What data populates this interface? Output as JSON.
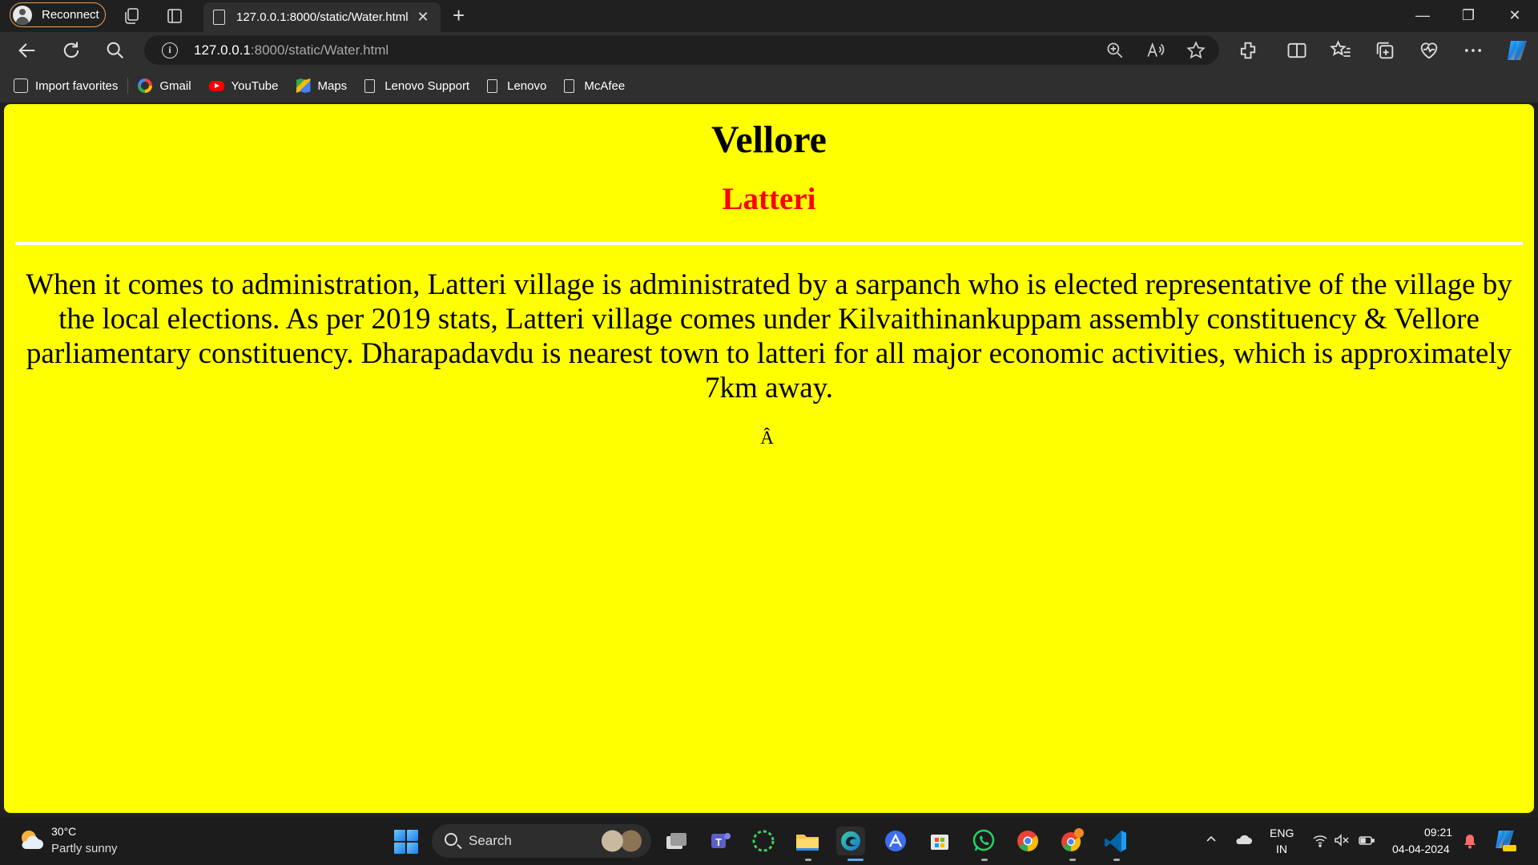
{
  "browser": {
    "profile_label": "Reconnect",
    "tab_title": "127.0.0.1:8000/static/Water.html",
    "tab_close": "✕",
    "new_tab": "+",
    "url_host": "127.0.0.1",
    "url_path": ":8000/static/Water.html",
    "info_glyph": "i",
    "window_controls": {
      "minimize": "—",
      "restore": "❐",
      "close": "✕"
    }
  },
  "favorites": [
    {
      "label": "Import favorites",
      "icon": "import-icon"
    },
    {
      "label": "Gmail",
      "icon": "google-icon"
    },
    {
      "label": "YouTube",
      "icon": "youtube-icon"
    },
    {
      "label": "Maps",
      "icon": "maps-icon"
    },
    {
      "label": "Lenovo Support",
      "icon": "document-icon"
    },
    {
      "label": "Lenovo",
      "icon": "document-icon"
    },
    {
      "label": "McAfee",
      "icon": "document-icon"
    }
  ],
  "page": {
    "heading": "Vellore",
    "subheading": "Latteri",
    "paragraph": "When it comes to administration, Latteri village is administrated by a sarpanch who is elected representative of the village by the local elections. As per 2019 stats, Latteri village comes under Kilvaithinankuppam assembly constituency & Vellore parliamentary constituency. Dharapadavdu is nearest town to latteri for all major economic activities, which is approximately 7km away.",
    "stray_char": "Â",
    "colors": {
      "background": "#ffff00",
      "subheading": "#ff0000",
      "rule": "#ffffff"
    }
  },
  "taskbar": {
    "weather_temp": "30°C",
    "weather_desc": "Partly sunny",
    "search_label": "Search",
    "lang_top": "ENG",
    "lang_bottom": "IN",
    "time": "09:21",
    "date": "04-04-2024"
  }
}
